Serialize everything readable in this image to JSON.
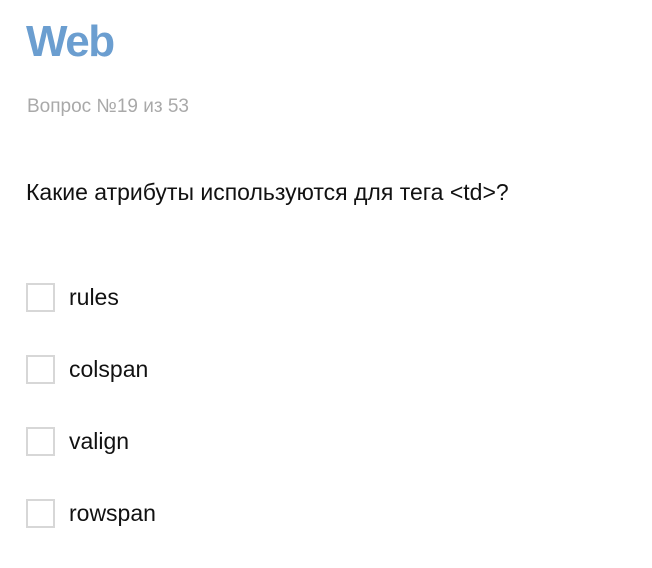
{
  "header": {
    "title": "Web",
    "counter": "Вопрос №19 из 53"
  },
  "question": {
    "text": "Какие атрибуты используются для тега <td>?"
  },
  "options": [
    {
      "label": "rules",
      "checked": false
    },
    {
      "label": "colspan",
      "checked": false
    },
    {
      "label": "valign",
      "checked": false
    },
    {
      "label": "rowspan",
      "checked": false
    }
  ],
  "colors": {
    "title": "#6b9ed0",
    "counter": "#a9a9a9",
    "checkbox_border": "#d7d7d7"
  }
}
